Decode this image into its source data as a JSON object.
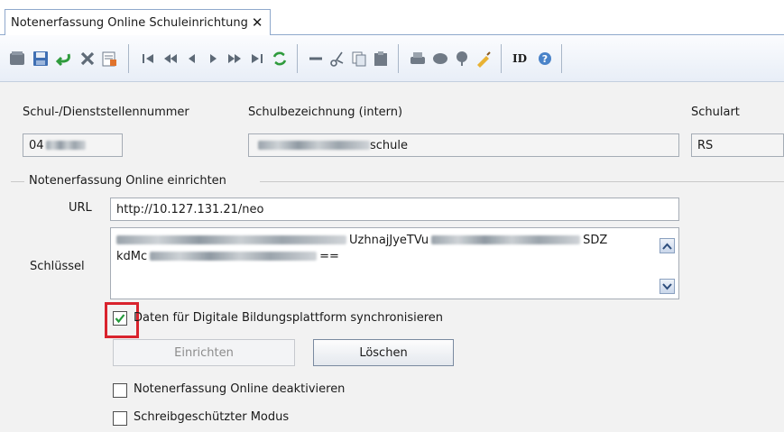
{
  "tab": {
    "title": "Notenerfassung Online Schuleinrichtung",
    "close": "✕"
  },
  "toolbar": {
    "icons": [
      "record-icon",
      "save-icon",
      "undo-icon",
      "delete-icon",
      "list-edit-icon",
      "first-icon",
      "prev-page-icon",
      "prev-icon",
      "next-icon",
      "next-page-icon",
      "last-icon",
      "refresh-icon",
      "back-arrow-icon",
      "cut-icon",
      "copy-icon",
      "paste-icon",
      "print-icon",
      "preview-icon",
      "pin-icon",
      "clear-icon",
      "id-icon",
      "help-icon"
    ],
    "id_label": "ID"
  },
  "form": {
    "col1_label": "Schul-/Dienststellennummer",
    "col2_label": "Schulbezeichnung (intern)",
    "col3_label": "Schulart",
    "school_number_prefix": "04",
    "school_name_suffix": "schule",
    "school_type": "RS"
  },
  "group": {
    "title": "Notenerfassung Online einrichten",
    "url_label": "URL",
    "url_value": "http://10.127.131.21/neo",
    "key_label": "Schlüssel",
    "key_line1_part": "UzhnajJyeTVu",
    "key_line1_end": "SDZ",
    "key_line2_start": "kdMc",
    "key_line2_end": "==",
    "sync_label": "Daten für Digitale Bildungsplattform synchronisieren",
    "sync_checked": true,
    "setup_button": "Einrichten",
    "delete_button": "Löschen",
    "deactivate_label": "Notenerfassung Online deaktivieren",
    "readonly_label": "Schreibgeschützter Modus"
  }
}
